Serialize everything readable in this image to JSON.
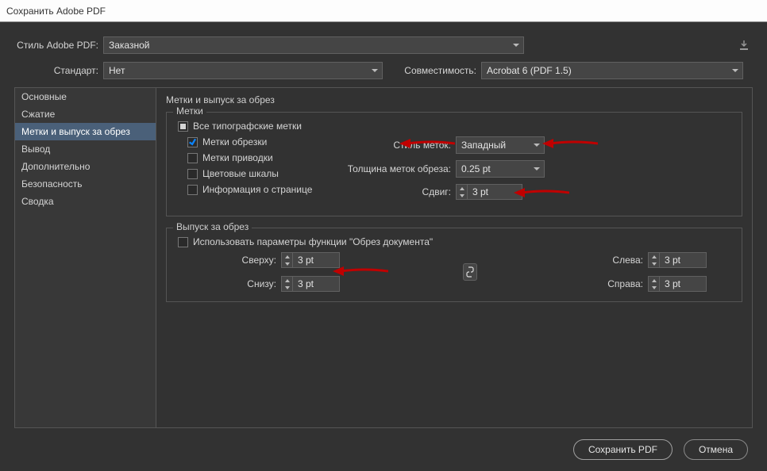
{
  "title": "Сохранить Adobe PDF",
  "topbar": {
    "style_label": "Стиль Adobe PDF:",
    "style_value": "Заказной",
    "standard_label": "Стандарт:",
    "standard_value": "Нет",
    "compat_label": "Совместимость:",
    "compat_value": "Acrobat 6 (PDF 1.5)"
  },
  "nav": {
    "items": [
      "Основные",
      "Сжатие",
      "Метки и выпуск за обрез",
      "Вывод",
      "Дополнительно",
      "Безопасность",
      "Сводка"
    ],
    "selected_index": 2
  },
  "main": {
    "heading": "Метки и выпуск за обрез",
    "marks": {
      "legend": "Метки",
      "all_label": "Все типографские метки",
      "crop_marks": "Метки обрезки",
      "reg_marks": "Метки приводки",
      "color_bars": "Цветовые шкалы",
      "page_info": "Информация о странице",
      "mark_style_label": "Стиль меток:",
      "mark_style_value": "Западный",
      "weight_label": "Толщина меток обреза:",
      "weight_value": "0.25 pt",
      "offset_label": "Сдвиг:",
      "offset_value": "3 pt"
    },
    "bleed": {
      "legend": "Выпуск за обрез",
      "use_doc_label": "Использовать параметры функции \"Обрез документа\"",
      "top_label": "Сверху:",
      "top_value": "3 pt",
      "bottom_label": "Снизу:",
      "bottom_value": "3 pt",
      "left_label": "Слева:",
      "left_value": "3 pt",
      "right_label": "Справа:",
      "right_value": "3 pt"
    }
  },
  "footer": {
    "save": "Сохранить PDF",
    "cancel": "Отмена"
  }
}
